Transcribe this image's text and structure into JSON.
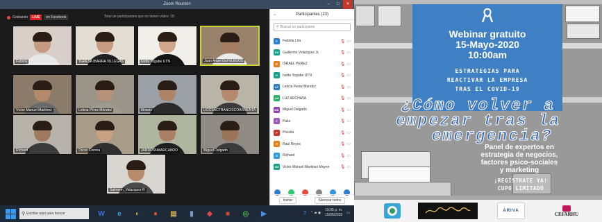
{
  "zoom": {
    "window_title": "Zoom Reunión",
    "live_label": "LIVE",
    "recording_label": "Grabando",
    "facebook_label": "en Facebook",
    "banner": "Total de participantes que no tienen vídeo: 18",
    "window_controls": [
      "–",
      "□",
      "✕"
    ],
    "tiles": [
      {
        "name": "Fabiola",
        "bg": "#d8d0c8",
        "body": "#e8e8e8",
        "skin": "#c49a80"
      },
      {
        "name": "TERESA IBARRA VILLEGAS",
        "bg": "#e4ddd3",
        "body": "#202020",
        "skin": "#c79b80"
      },
      {
        "name": "Ivette Yogabe UTN",
        "bg": "#f0efe9",
        "body": "#151515",
        "skin": "#d1a68a"
      },
      {
        "name": "Juan Angel Gol NLEGOS",
        "bg": "#98836a",
        "body": "#eaeaea",
        "skin": "#a57d62"
      },
      {
        "name": "Víctor Manuel Martínez",
        "bg": "#8a7b6a",
        "body": "#6a6a6a",
        "skin": "#b38a6a"
      },
      {
        "name": "Leticia Pérez Méndez",
        "bg": "#9a9388",
        "body": "#9f9a90",
        "skin": "#b69378"
      },
      {
        "name": "Moisés",
        "bg": "#9aa0a6",
        "body": "#2a2a2a",
        "skin": "#ad8466"
      },
      {
        "name": "LICCSACFRANCISCOARMENTA",
        "bg": "#b9b4a8",
        "body": "#3a3a3a",
        "skin": "#b5896d"
      },
      {
        "name": "Richard",
        "bg": "#b8b3aa",
        "body": "#3a3a3a",
        "skin": "#a07a5e"
      },
      {
        "name": "Oscar Corona",
        "bg": "#a99c88",
        "body": "#2f2f2f",
        "skin": "#caa083"
      },
      {
        "name": "JANDOSNMARCANDO",
        "bg": "#aeb6a0",
        "body": "#1e1e1e",
        "skin": "#a98063"
      },
      {
        "name": "Miguel Delgado",
        "bg": "#8f8a84",
        "body": "#3b3b3b",
        "skin": "#9c7458"
      },
      {
        "name": "Salmerin_Velazquez R",
        "bg": "#d8d6d0",
        "body": "#4a4a4a",
        "skin": "#b58b6c"
      }
    ],
    "participants_title": "Participantes (23)",
    "search_placeholder": "Buscar un participante",
    "participants": [
      {
        "initials": "F",
        "name": "Fabiola Lira",
        "color": "#2f7dd1"
      },
      {
        "initials": "GV",
        "name": "Guillermo Velázquez Jr.",
        "color": "#1aa38a"
      },
      {
        "initials": "IP",
        "name": "ISRAEL PEREZ",
        "color": "#e67e22"
      },
      {
        "initials": "IY",
        "name": "Ivette Yogabe UTN",
        "color": "#16a085"
      },
      {
        "initials": "LP",
        "name": "Leticia Perez Mendez",
        "color": "#2980b9"
      },
      {
        "initials": "LM",
        "name": "LUZ ARCHAVA",
        "color": "#27ae60"
      },
      {
        "initials": "MD",
        "name": "Miguel Delgado",
        "color": "#8e44ad"
      },
      {
        "initials": "P",
        "name": "Pako",
        "color": "#9b59b6"
      },
      {
        "initials": "P",
        "name": "Priscila",
        "color": "#c0392b"
      },
      {
        "initials": "R",
        "name": "Raúl Reyes",
        "color": "#e67e22"
      },
      {
        "initials": "R",
        "name": "Richard",
        "color": "#3498db"
      },
      {
        "initials": "VM",
        "name": "Victor Manuel Martinez Mayen",
        "color": "#16a085"
      }
    ],
    "reactions": [
      "#2f7dd1",
      "#2ecc71",
      "#e74c3c",
      "#888888",
      "#3498db",
      "#2f7dd1"
    ],
    "invite_label": "Invitar",
    "mute_all_label": "Silenciar todos"
  },
  "taskbar": {
    "search_placeholder": "Escribe aquí para buscar",
    "clock_time": "19:05 p. m.",
    "clock_date": "15/05/2020",
    "app_icons": [
      {
        "glyph": "W",
        "color": "#3b6fd4"
      },
      {
        "glyph": "e",
        "color": "#3a9be0"
      },
      {
        "glyph": "◐",
        "color": "#e8a33c"
      },
      {
        "glyph": "●",
        "color": "#e05a2a"
      },
      {
        "glyph": "▤",
        "color": "#d0b050"
      },
      {
        "glyph": "▮",
        "color": "#7a9cc6"
      },
      {
        "glyph": "◆",
        "color": "#e04848"
      },
      {
        "glyph": "■",
        "color": "#d04a3a"
      },
      {
        "glyph": "◎",
        "color": "#4caf50"
      },
      {
        "glyph": "▶",
        "color": "#4a90e2"
      }
    ]
  },
  "poster": {
    "title_line1": "Webinar gratuito",
    "title_line2": "15-Mayo-2020",
    "title_line3": "10:00am",
    "subtitle_line1": "ESTRATEGIAS PARA",
    "subtitle_line2": "REACTIVAR LA EMPRESA",
    "subtitle_line3": "TRAS EL COVID-19",
    "question_line1": "¿Cómo volver a",
    "question_line2": "empezar tras la",
    "question_line3": "emergencia?",
    "panel_line1": "Panel de expertos en",
    "panel_line2": "estrategia de negocios,",
    "panel_line3": "factores psico-sociales",
    "panel_line4": "y marketing",
    "register_line1": "¡REGÍSTRATE YA!",
    "register_line2": "CUPO LIMITADO",
    "logos": [
      "",
      "",
      "ARIVA",
      "CEFARHU"
    ]
  }
}
